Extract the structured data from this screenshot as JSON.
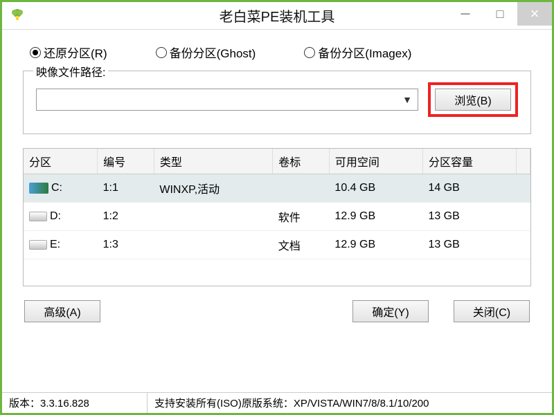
{
  "window": {
    "title": "老白菜PE装机工具"
  },
  "radios": {
    "restore": "还原分区(R)",
    "backupGhost": "备份分区(Ghost)",
    "backupImagex": "备份分区(Imagex)"
  },
  "pathPanel": {
    "label": "映像文件路径:",
    "browse": "浏览(B)"
  },
  "table": {
    "headers": {
      "partition": "分区",
      "number": "编号",
      "type": "类型",
      "volume": "卷标",
      "free": "可用空间",
      "capacity": "分区容量"
    },
    "rows": [
      {
        "drive": "C:",
        "num": "1:1",
        "type": "WINXP,活动",
        "vol": "",
        "free": "10.4 GB",
        "cap": "14 GB"
      },
      {
        "drive": "D:",
        "num": "1:2",
        "type": "",
        "vol": "软件",
        "free": "12.9 GB",
        "cap": "13 GB"
      },
      {
        "drive": "E:",
        "num": "1:3",
        "type": "",
        "vol": "文档",
        "free": "12.9 GB",
        "cap": "13 GB"
      }
    ]
  },
  "buttons": {
    "advanced": "高级(A)",
    "ok": "确定(Y)",
    "close": "关闭(C)"
  },
  "status": {
    "version": "版本：3.3.16.828",
    "support": "支持安装所有(ISO)原版系统：XP/VISTA/WIN7/8/8.1/10/200"
  }
}
